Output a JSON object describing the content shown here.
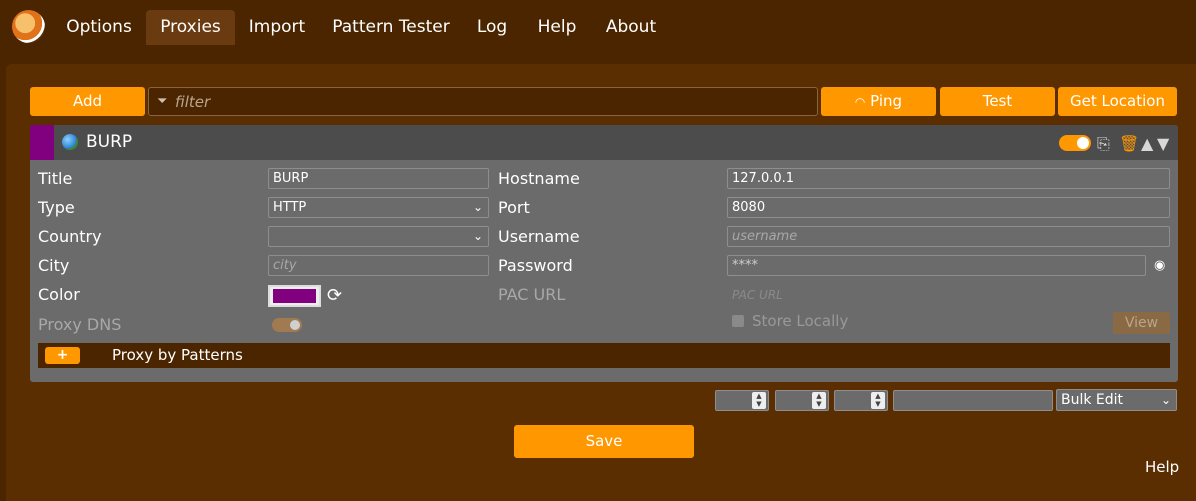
{
  "nav": {
    "tabs": [
      "Options",
      "Proxies",
      "Import",
      "Pattern Tester",
      "Log",
      "Help",
      "About"
    ],
    "active": "Proxies"
  },
  "toolbar": {
    "add_label": "Add",
    "filter_placeholder": "filter",
    "ping_label": "Ping",
    "test_label": "Test",
    "location_label": "Get Location"
  },
  "proxy": {
    "name": "BURP",
    "enabled": true,
    "strip_color": "#800080",
    "fields": {
      "title_label": "Title",
      "title_value": "BURP",
      "type_label": "Type",
      "type_value": "HTTP",
      "country_label": "Country",
      "country_value": "",
      "city_label": "City",
      "city_placeholder": "city",
      "color_label": "Color",
      "color_value": "#800080",
      "proxy_dns_label": "Proxy DNS",
      "hostname_label": "Hostname",
      "hostname_value": "127.0.0.1",
      "port_label": "Port",
      "port_value": "8080",
      "username_label": "Username",
      "username_placeholder": "username",
      "password_label": "Password",
      "password_value": "****",
      "pac_url_label": "PAC URL",
      "pac_url_placeholder": "PAC URL",
      "store_locally_label": "Store Locally",
      "view_label": "View"
    },
    "patterns_label": "Proxy by Patterns",
    "patterns_add": "+"
  },
  "footer": {
    "bulk_edit_label": "Bulk Edit",
    "save_label": "Save",
    "help_label": "Help"
  },
  "colors": {
    "accent": "#ff9800",
    "background": "#4a2500",
    "card": "#6b6b6b"
  }
}
